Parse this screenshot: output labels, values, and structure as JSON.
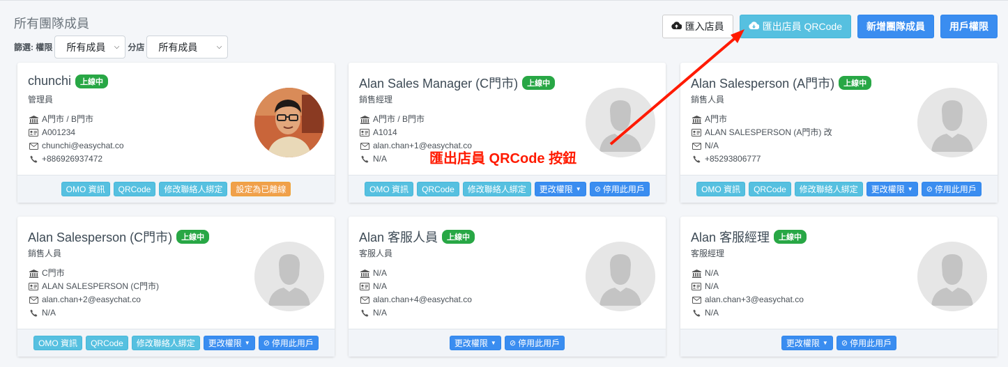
{
  "header": {
    "title": "所有團隊成員",
    "filter_label": "篩選: 權限",
    "filter_value": "所有成員",
    "branch_label": "分店",
    "branch_value": "所有成員",
    "actions": {
      "import": "匯入店員",
      "export": "匯出店員 QRCode",
      "add": "新增團隊成員",
      "permissions": "用戶權限"
    }
  },
  "annotation": {
    "text": "匯出店員 QRCode 按鈕",
    "color": "#ff1a00"
  },
  "colors": {
    "online_badge": "#28a745",
    "info_button": "#56c0e0",
    "primary_button": "#3a8df0",
    "warning_button": "#f0a04b"
  },
  "members": [
    {
      "name": "chunchi",
      "status": "上線中",
      "role": "管理員",
      "store": "A門市 / B門市",
      "staff_id": "A001234",
      "email": "chunchi@easychat.co",
      "phone": "+886926937472",
      "avatar": "photo",
      "buttons": {
        "omo": "OMO 資訊",
        "qr": "QRCode",
        "bind": "修改聯絡人綁定",
        "leave": "設定為已離線"
      }
    },
    {
      "name": "Alan Sales Manager (C門市)",
      "status": "上線中",
      "role": "銷售經理",
      "store": "A門市 / B門市",
      "staff_id": "A1014",
      "email": "alan.chan+1@easychat.co",
      "phone": "N/A",
      "avatar": "default",
      "buttons": {
        "omo": "OMO 資訊",
        "qr": "QRCode",
        "bind": "修改聯絡人綁定",
        "perm": "更改權限",
        "disable": "停用此用戶"
      }
    },
    {
      "name": "Alan Salesperson (A門市)",
      "status": "上線中",
      "role": "銷售人員",
      "store": "A門市",
      "staff_id": "ALAN SALESPERSON (A門市) 改",
      "email": "N/A",
      "phone": "+85293806777",
      "avatar": "default",
      "buttons": {
        "omo": "OMO 資訊",
        "qr": "QRCode",
        "bind": "修改聯絡人綁定",
        "perm": "更改權限",
        "disable": "停用此用戶"
      }
    },
    {
      "name": "Alan Salesperson (C門市)",
      "status": "上線中",
      "role": "銷售人員",
      "store": "C門市",
      "staff_id": "ALAN SALESPERSON (C門市)",
      "email": "alan.chan+2@easychat.co",
      "phone": "N/A",
      "avatar": "default",
      "buttons": {
        "omo": "OMO 資訊",
        "qr": "QRCode",
        "bind": "修改聯絡人綁定",
        "perm": "更改權限",
        "disable": "停用此用戶"
      }
    },
    {
      "name": "Alan 客服人員",
      "status": "上線中",
      "role": "客服人員",
      "store": "N/A",
      "staff_id": "N/A",
      "email": "alan.chan+4@easychat.co",
      "phone": "N/A",
      "avatar": "default",
      "buttons": {
        "perm": "更改權限",
        "disable": "停用此用戶"
      }
    },
    {
      "name": "Alan 客服經理",
      "status": "上線中",
      "role": "客服經理",
      "store": "N/A",
      "staff_id": "N/A",
      "email": "alan.chan+3@easychat.co",
      "phone": "N/A",
      "avatar": "default",
      "buttons": {
        "perm": "更改權限",
        "disable": "停用此用戶"
      }
    }
  ]
}
